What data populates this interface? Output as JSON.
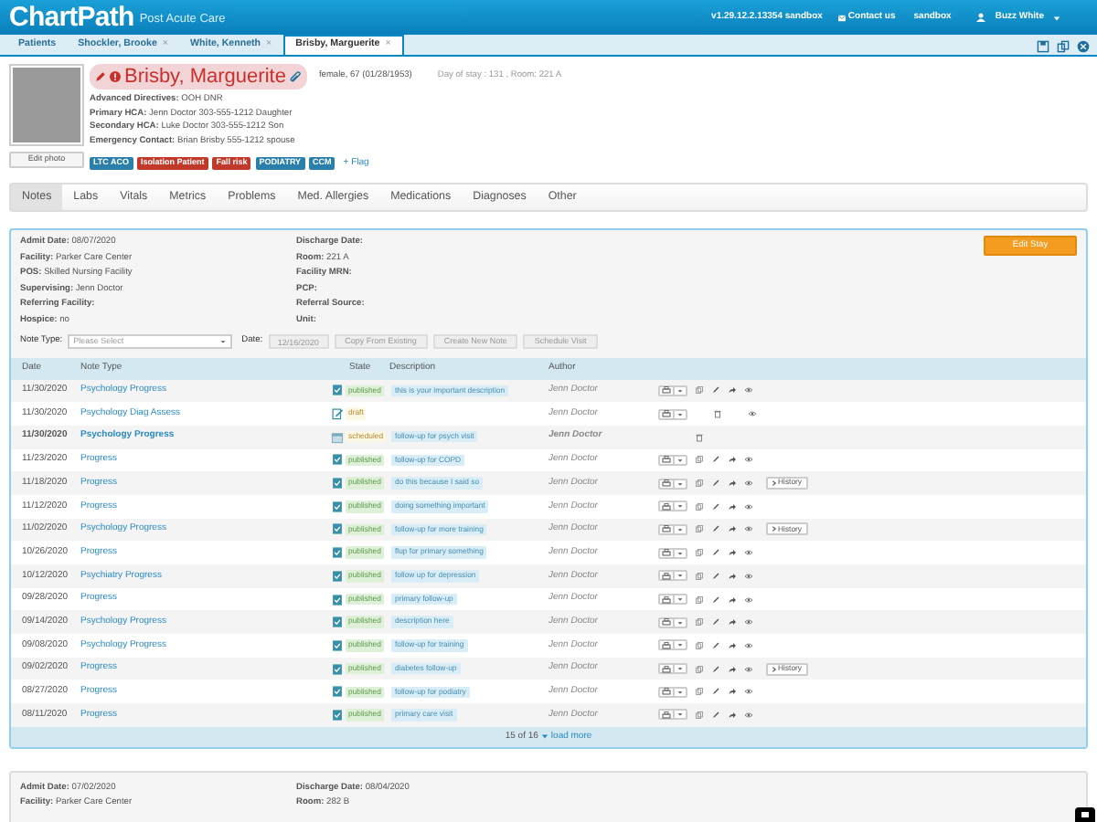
{
  "header": {
    "logo": "ChartPath",
    "subtitle": "Post Acute Care",
    "version": "v1.29.12.2.13354 sandbox",
    "contact": "Contact us",
    "env": "sandbox",
    "user": "Buzz White"
  },
  "patient_tabs": [
    {
      "label": "Patients",
      "selected": false,
      "closable": false
    },
    {
      "label": "Shockler, Brooke",
      "selected": false,
      "closable": true
    },
    {
      "label": "White, Kenneth",
      "selected": false,
      "closable": true
    },
    {
      "label": "Brisby, Marguerite",
      "selected": true,
      "closable": true
    }
  ],
  "close_glyph": "×",
  "patient": {
    "name": "Brisby, Marguerite",
    "demographics": "female, 67 (01/28/1953)",
    "stay_info": "Day of stay : 131 , Room: 221 A",
    "details": [
      "**Advanced Directives:** OOH DNR",
      "**Primary HCA:** Jenn Doctor 303-555-1212 Daughter",
      "**Secondary HCA:** Luke Doctor 303-555-1212 Son",
      "**Emergency Contact:** Brian Brisby 555-1212 spouse"
    ],
    "edit_photo": "Edit photo",
    "flags": [
      {
        "label": "LTC ACO",
        "color": "#2b7fab"
      },
      {
        "label": "Isolation Patient",
        "color": "#c0392b"
      },
      {
        "label": "Fall risk",
        "color": "#c0392b"
      },
      {
        "label": "PODIATRY",
        "color": "#2b7fab"
      },
      {
        "label": "CCM",
        "color": "#2b7fab"
      }
    ],
    "add_flag": "+ Flag"
  },
  "section_tabs": [
    {
      "label": "Notes",
      "selected": true
    },
    {
      "label": "Labs",
      "selected": false
    },
    {
      "label": "Vitals",
      "selected": false
    },
    {
      "label": "Metrics",
      "selected": false
    },
    {
      "label": "Problems",
      "selected": false
    },
    {
      "label": "Med. Allergies",
      "selected": false
    },
    {
      "label": "Medications",
      "selected": false
    },
    {
      "label": "Diagnoses",
      "selected": false
    },
    {
      "label": "Other",
      "selected": false
    }
  ],
  "stay": {
    "left": [
      "**Admit Date:** 08/07/2020",
      "**Facility:** Parker Care Center",
      "**POS:** Skilled Nursing Facility",
      "**Supervising:** Jenn Doctor",
      "**Referring Facility:**",
      "**Hospice:** no"
    ],
    "right": [
      "**Discharge Date:**",
      "**Room:** 221 A",
      "**Facility MRN:**",
      "**PCP:**",
      "**Referral Source:**",
      "**Unit:**"
    ],
    "edit_button": "Edit Stay",
    "note_type_label": "Note Type:",
    "note_type_placeholder": "Please Select",
    "date_label": "Date:",
    "date_value": "12/16/2020",
    "buttons": [
      "Copy From Existing",
      "Create New Note",
      "Schedule Visit"
    ],
    "table": {
      "columns": [
        "Date",
        "Note Type",
        "State",
        "Description",
        "Author"
      ],
      "rows": [
        {
          "date": "11/30/2020",
          "type": "Psychology Progress",
          "kind": "published",
          "state": "published",
          "description": "this is your important description",
          "author": "Jenn Doctor"
        },
        {
          "date": "11/30/2020",
          "type": "Psychology Diag Assess",
          "kind": "draft",
          "state": "draft",
          "author": "Jenn Doctor"
        },
        {
          "date": "11/30/2020",
          "type": "Psychology Progress",
          "kind": "scheduled",
          "state": "scheduled",
          "description": "follow-up for psych visit",
          "author": "Jenn Doctor"
        },
        {
          "date": "11/23/2020",
          "type": "Progress",
          "kind": "published",
          "state": "published",
          "description": "follow-up for COPD",
          "author": "Jenn Doctor"
        },
        {
          "date": "11/18/2020",
          "type": "Progress",
          "kind": "published",
          "state": "published",
          "description": "do this because I said so",
          "author": "Jenn Doctor",
          "history": "History"
        },
        {
          "date": "11/12/2020",
          "type": "Progress",
          "kind": "published",
          "state": "published",
          "description": "doing something important",
          "author": "Jenn Doctor"
        },
        {
          "date": "11/02/2020",
          "type": "Psychology Progress",
          "kind": "published",
          "state": "published",
          "description": "follow-up for more training",
          "author": "Jenn Doctor",
          "history": "History"
        },
        {
          "date": "10/26/2020",
          "type": "Progress",
          "kind": "published",
          "state": "published",
          "description": "flup for primary something",
          "author": "Jenn Doctor"
        },
        {
          "date": "10/12/2020",
          "type": "Psychiatry Progress",
          "kind": "published",
          "state": "published",
          "description": "follow up for depression",
          "author": "Jenn Doctor"
        },
        {
          "date": "09/28/2020",
          "type": "Progress",
          "kind": "published",
          "state": "published",
          "description": "primary follow-up",
          "author": "Jenn Doctor"
        },
        {
          "date": "09/14/2020",
          "type": "Psychology Progress",
          "kind": "published",
          "state": "published",
          "description": "description here",
          "author": "Jenn Doctor"
        },
        {
          "date": "09/08/2020",
          "type": "Psychology Progress",
          "kind": "published",
          "state": "published",
          "description": "follow-up for training",
          "author": "Jenn Doctor"
        },
        {
          "date": "09/02/2020",
          "type": "Progress",
          "kind": "published",
          "state": "published",
          "description": "diabetes follow-up",
          "author": "Jenn Doctor",
          "history": "History"
        },
        {
          "date": "08/27/2020",
          "type": "Progress",
          "kind": "published",
          "state": "published",
          "description": "follow-up for podiatry",
          "author": "Jenn Doctor"
        },
        {
          "date": "08/11/2020",
          "type": "Progress",
          "kind": "published",
          "state": "published",
          "description": "primary care visit",
          "author": "Jenn Doctor"
        }
      ],
      "count": "15 of 16",
      "load_more": "load more"
    }
  },
  "previous_stay": {
    "left": [
      "**Admit Date:** 07/02/2020",
      "**Facility:** Parker Care Center"
    ],
    "right": [
      "**Discharge Date:** 08/04/2020",
      "**Room:** 282 B"
    ]
  }
}
